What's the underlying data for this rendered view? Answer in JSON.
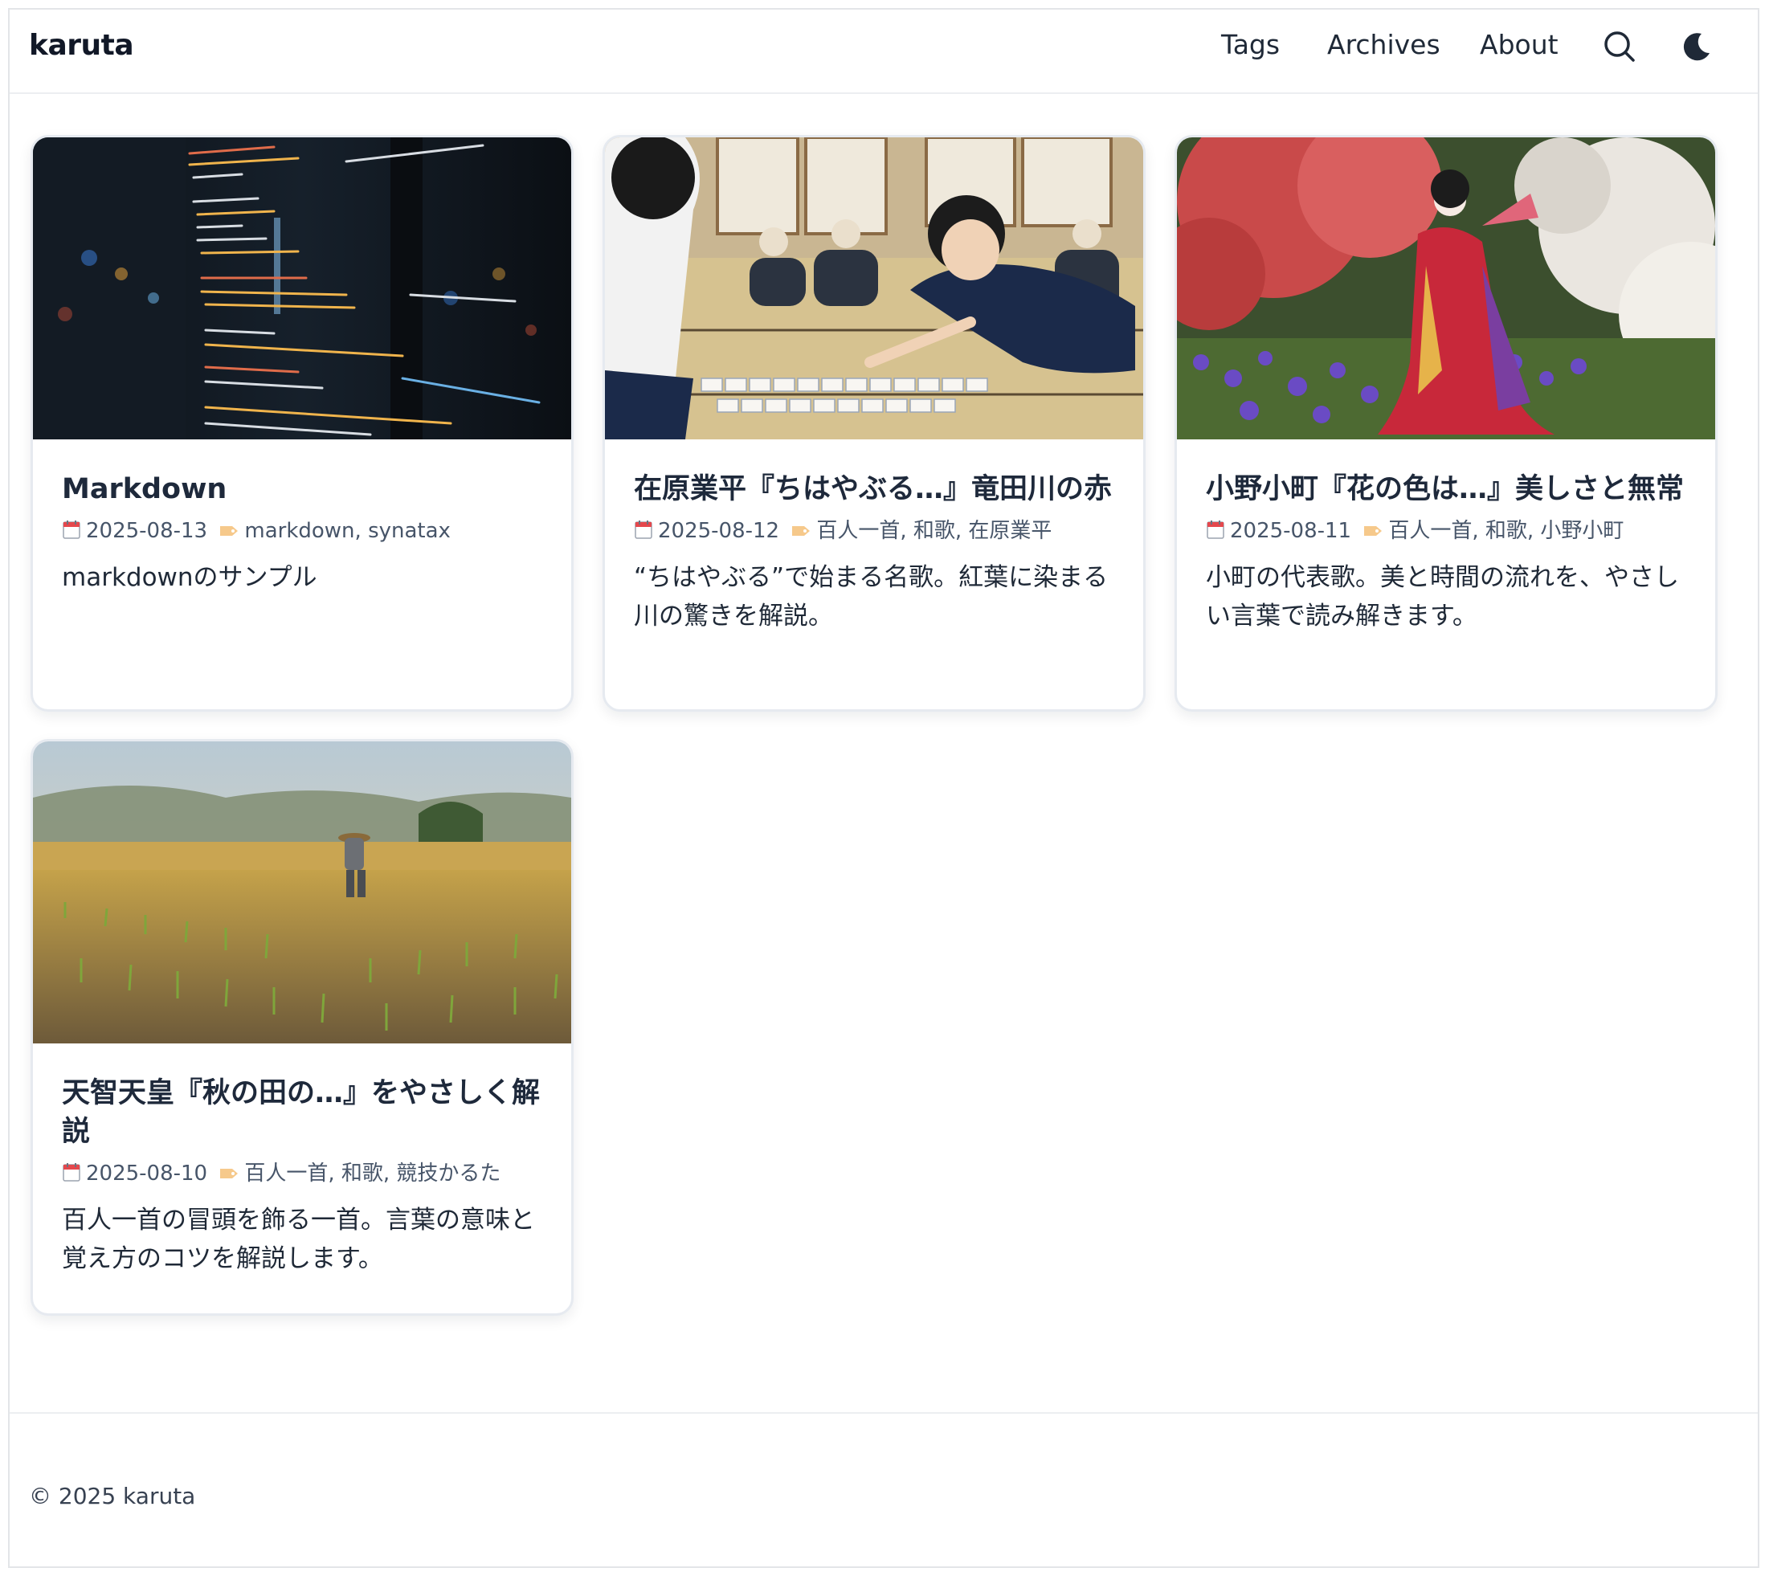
{
  "header": {
    "brand": "karuta",
    "nav": [
      "Tags",
      "Archives",
      "About"
    ],
    "search_icon": "search-icon",
    "theme_icon": "moon-icon"
  },
  "posts": [
    {
      "title": "Markdown",
      "date": "2025-08-13",
      "tags": "markdown, synatax",
      "excerpt": "markdownのサンプル",
      "image": "code-on-screen-night-city"
    },
    {
      "title": "在原業平『ちはやぶる…』竜田川の赤",
      "date": "2025-08-12",
      "tags": "百人一首, 和歌, 在原業平",
      "excerpt": "“ちはやぶる”で始まる名歌。紅葉に染まる川の驚きを解説。",
      "image": "karuta-competition"
    },
    {
      "title": "小野小町『花の色は…』美しさと無常",
      "date": "2025-08-11",
      "tags": "百人一首, 和歌, 小野小町",
      "excerpt": "小町の代表歌。美と時間の流れを、やさしい言葉で読み解きます。",
      "image": "kimono-woman-garden"
    },
    {
      "title": "天智天皇『秋の田の…』をやさしく解説",
      "date": "2025-08-10",
      "tags": "百人一首, 和歌, 競技かるた",
      "excerpt": "百人一首の冒頭を飾る一首。言葉の意味と覚え方のコツを解説します。",
      "image": "rice-paddy-farmer"
    }
  ],
  "icons": {
    "date": "calendar-icon",
    "tags": "tag-icon"
  },
  "footer": {
    "copyright": "© 2025 karuta"
  }
}
